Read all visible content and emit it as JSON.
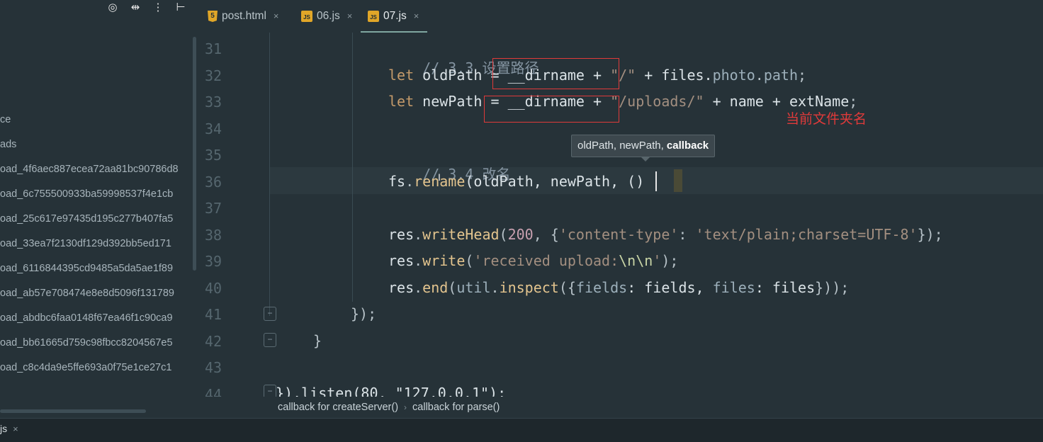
{
  "sidebar": {
    "files": [
      "ce",
      "ads",
      "oad_4f6aec887ecea72aa81bc90786d8",
      "oad_6c755500933ba59998537f4e1cb",
      "oad_25c617e97435d195c277b407fa5",
      "oad_33ea7f2130df129d392bb5ed171",
      "oad_6116844395cd9485a5da5ae1f89",
      "oad_ab57e708474e8e8d5096f131789",
      "oad_abdbc6faa0148f67ea46f1c90ca9",
      "oad_bb61665d759c98fbcc8204567e5",
      "oad_c8c4da9e5ffe693a0f75e1ce27c1"
    ]
  },
  "tabs": [
    {
      "label": "post.html",
      "icon": "html5-icon",
      "close": "×"
    },
    {
      "label": "06.js",
      "icon": "js-file-icon",
      "close": "×"
    },
    {
      "label": "07.js",
      "icon": "js-file-icon",
      "close": "×"
    }
  ],
  "js_badge": "JS",
  "html_badge": "5",
  "line_numbers": [
    "31",
    "32",
    "33",
    "34",
    "35",
    "36",
    "37",
    "38",
    "39",
    "40",
    "41",
    "42",
    "43",
    "44"
  ],
  "code": {
    "l31": {
      "comment": "// 3.3 设置路径"
    },
    "l32": {
      "kw": "let",
      "a": " oldPath = __dirname + ",
      "s": "\"/\"",
      "b": " + files.",
      "p1": "photo",
      "dot": ".",
      "p2": "path",
      "end": ";"
    },
    "l33": {
      "kw": "let",
      "a": " newPath = __dirname + ",
      "s": "\"/uploads/\"",
      "b": " + name + extName",
      "end": ";"
    },
    "l35": {
      "comment": "// 3.4 改名"
    },
    "l36": {
      "obj": "fs",
      "dot": ".",
      "fn": "rename",
      "args": "(oldPath, newPath, ",
      "tail": "()"
    },
    "l38": {
      "obj": "res",
      "dot": ".",
      "fn": "writeHead",
      "open": "(",
      "num": "200",
      "mid": ", {",
      "s1": "'content-type'",
      "colon": ": ",
      "s2": "'text/plain;charset=UTF-8'",
      "end": "});"
    },
    "l39": {
      "obj": "res",
      "dot": ".",
      "fn": "write",
      "open": "(",
      "s1": "'received upload:",
      "esc": "\\n\\n",
      "s2": "'",
      "end": ");"
    },
    "l40": {
      "obj": "res",
      "dot": ".",
      "fn": "end",
      "open": "(",
      "util": "util",
      "dot2": ".",
      "fn2": "inspect",
      "mid": "({",
      "k1": "fields",
      "c1": ": fields, ",
      "k2": "files",
      "c2": ": files",
      "end": "}));"
    },
    "l41": {
      "text": "});"
    },
    "l42": {
      "text": "}"
    },
    "l44": {
      "text": "}).listen(80, \"127.0.0.1\");"
    }
  },
  "annotation": "当前文件夹名",
  "tooltip": {
    "plain": "oldPath, newPath, ",
    "bold": "callback"
  },
  "breadcrumb": {
    "items": [
      "callback for createServer()",
      "callback for parse()"
    ],
    "sep": "›"
  },
  "bottom_tab": {
    "label": "js",
    "close": "×"
  },
  "toolbar_icons": [
    "target-icon",
    "collapse-icon",
    "menu-icon",
    "hide-icon"
  ],
  "colors": {
    "background": "#263238",
    "annotation_red": "#e03a3a",
    "keyword": "#c49a6a"
  }
}
